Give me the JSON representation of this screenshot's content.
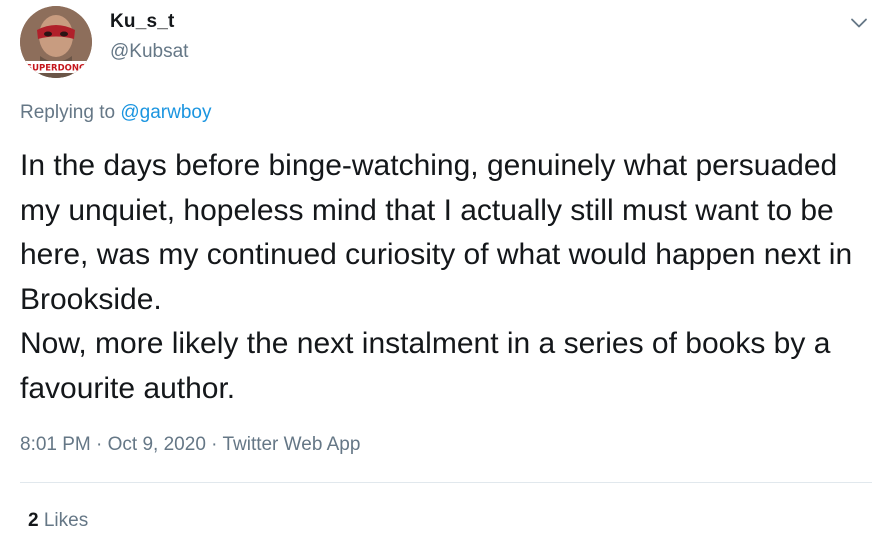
{
  "user": {
    "display_name": "Ku_s_t",
    "handle": "@Kubsat",
    "avatar_icon": "avatar-masked-face",
    "avatar_banner_text": "SUPERDONG"
  },
  "reply": {
    "prefix": "Replying to",
    "mention": "@garwboy"
  },
  "tweet": {
    "text": "In the days before binge-watching, genuinely what persuaded my unquiet, hopeless mind that I actually still must want to be here, was my continued curiosity of what would happen next in Brookside.\nNow, more likely the next instalment in a series of books by a favourite author."
  },
  "meta": {
    "time": "8:01 PM",
    "date": "Oct 9, 2020",
    "source": "Twitter Web App",
    "separator": "·"
  },
  "stats": {
    "likes_count": "2",
    "likes_label": "Likes"
  },
  "icons": {
    "more_menu": "chevron-down-icon"
  },
  "colors": {
    "text_primary": "#14171a",
    "text_secondary": "#657786",
    "link": "#1b95e0",
    "divider": "#e1e8ed"
  }
}
